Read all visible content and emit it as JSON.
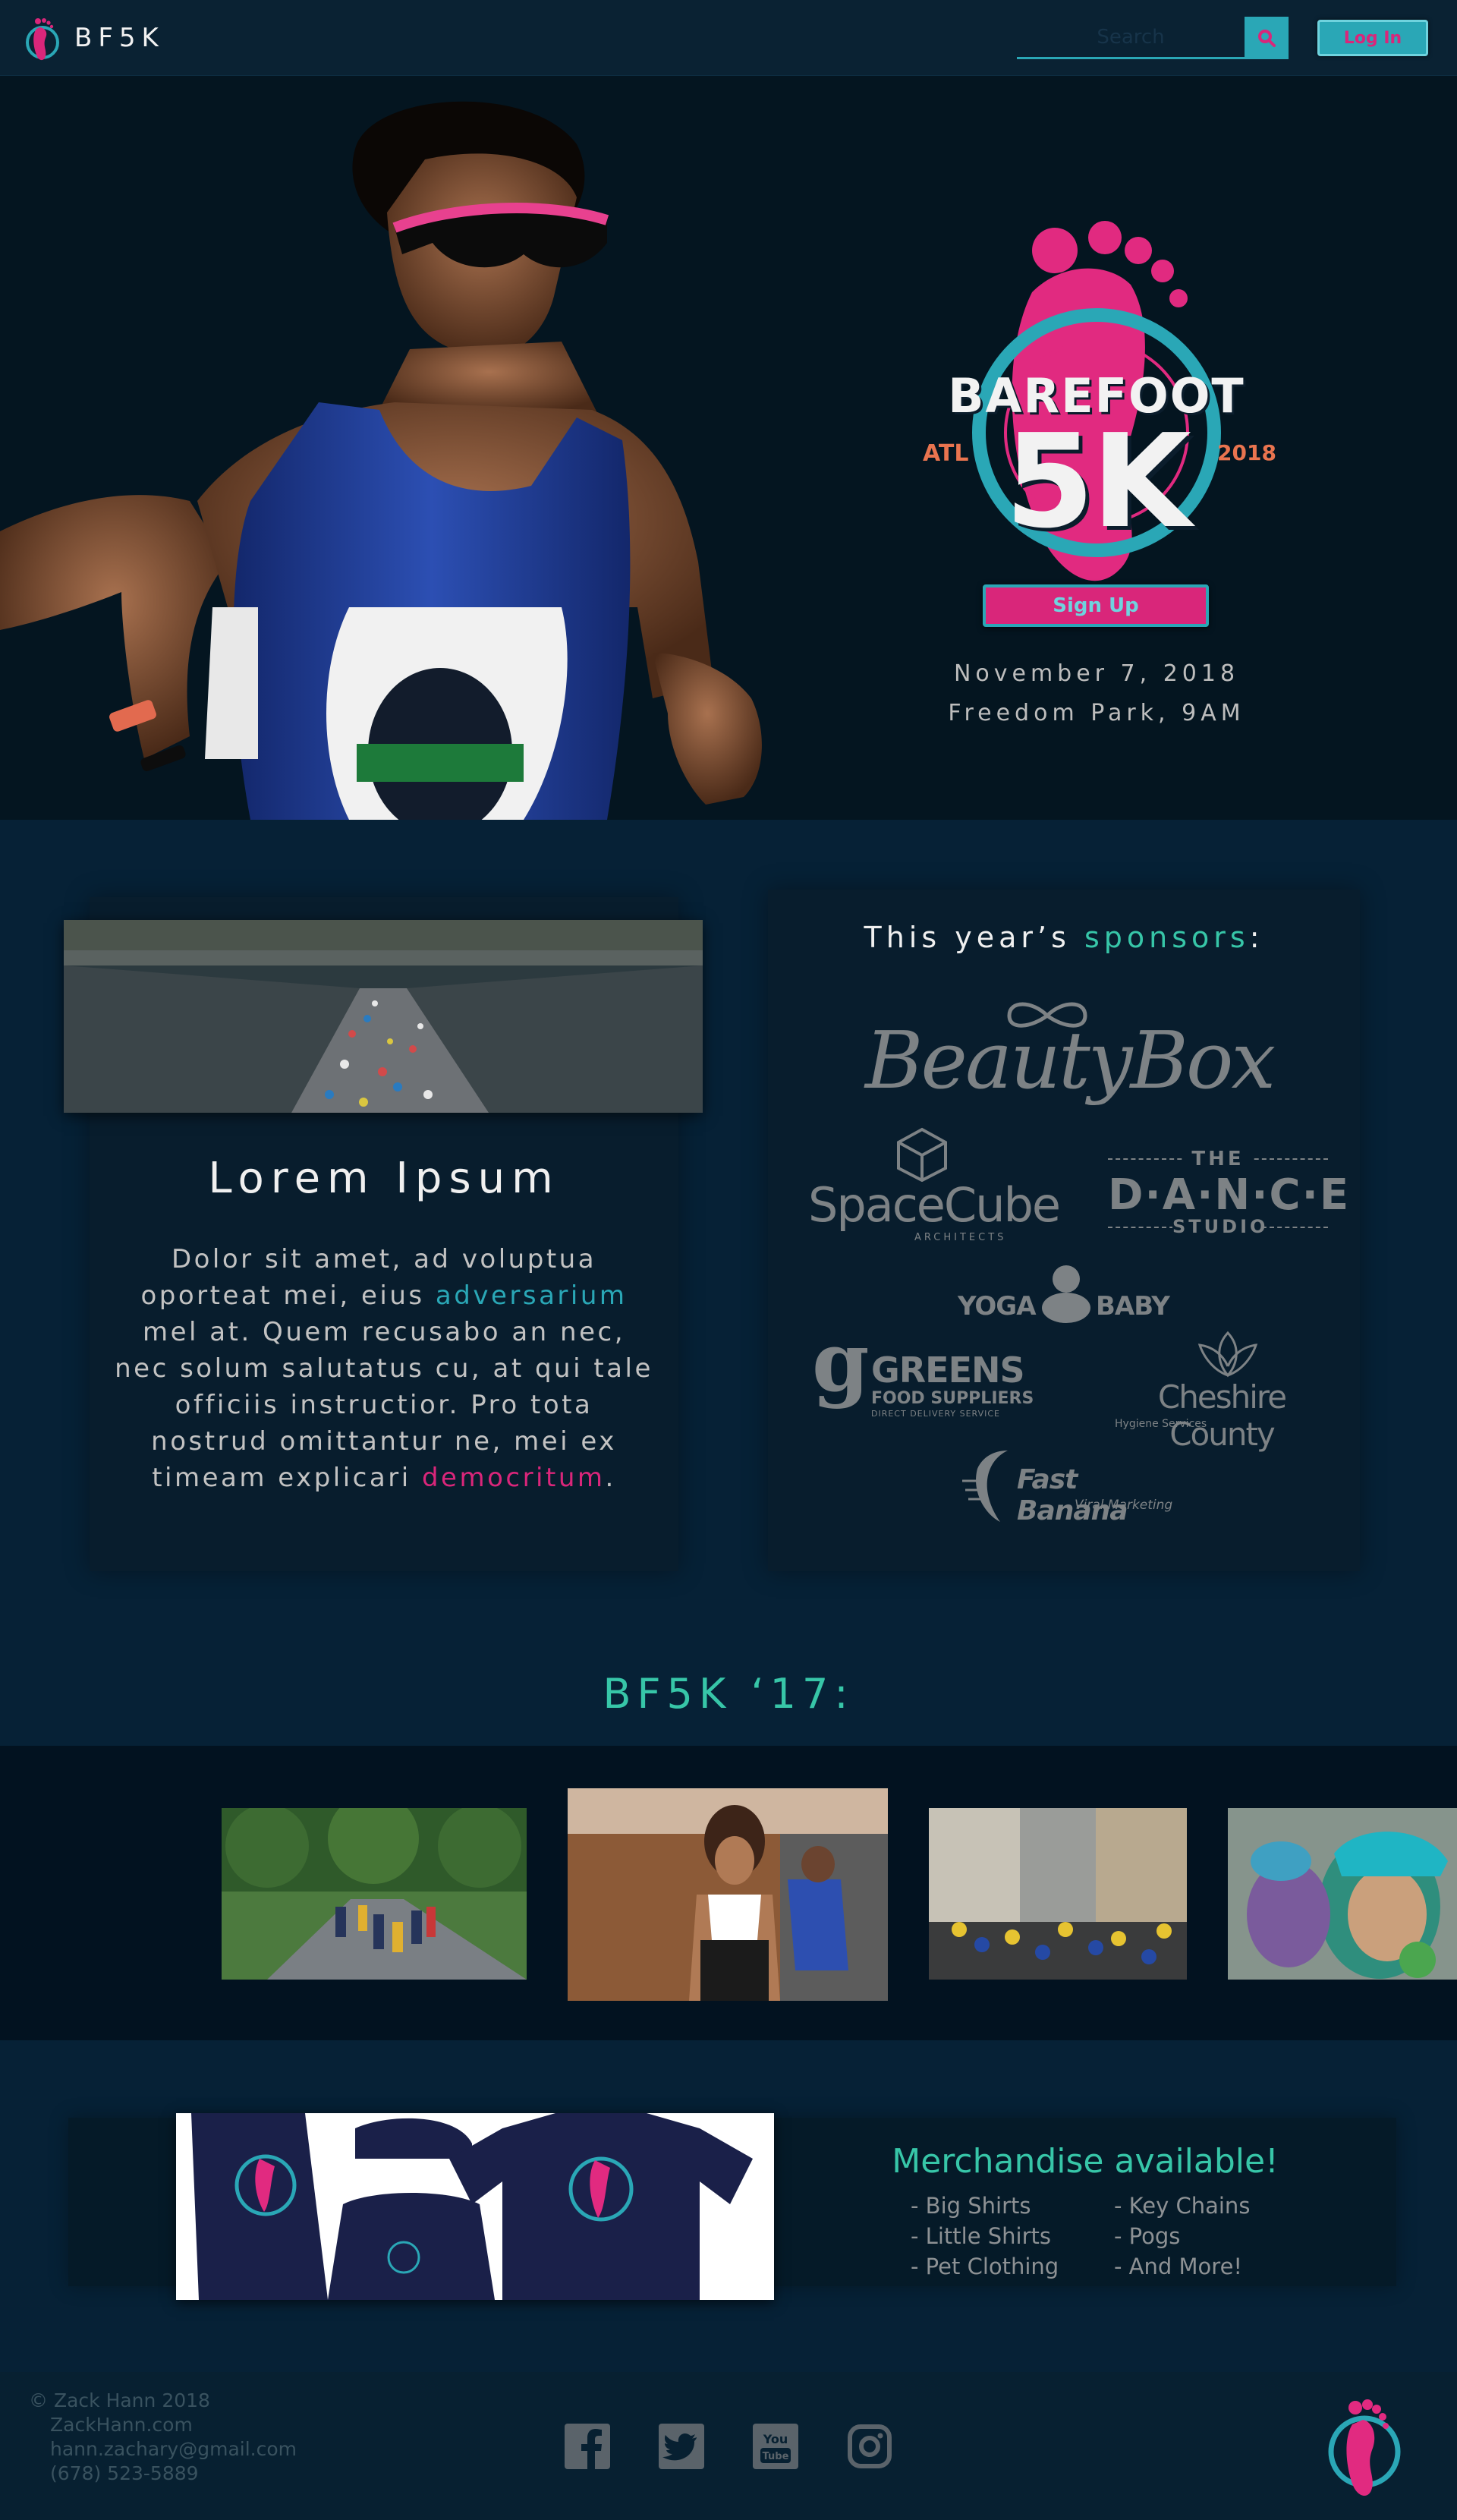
{
  "nav": {
    "brand": "BF5K",
    "search_placeholder": "Search",
    "login_label": "Log In"
  },
  "hero": {
    "logo_word_top": "BAREFOOT",
    "logo_word_main": "5K",
    "logo_left_tag": "ATL",
    "logo_right_tag": "2018",
    "signup_label": "Sign Up",
    "date": "November 7, 2018",
    "venue": "Freedom Park, 9AM"
  },
  "about": {
    "title": "Lorem Ipsum",
    "body_part1": "Dolor sit amet, ad voluptua oporteat mei, eius",
    "body_link1": "adversarium",
    "body_part2": "mel at. Quem recusabo an nec, nec solum salutatus cu, at qui tale officiis instructior. Pro tota nostrud omittantur ne, mei ex timeam explicari",
    "body_link2": "democritum",
    "body_end": "."
  },
  "sponsors": {
    "title_prefix": "This year’s",
    "title_highlight": "sponsors",
    "title_suffix": ":",
    "beauty_box": "BeautyBox",
    "spacecube": "SpaceCube",
    "spacecube_sub": "ARCHITECTS",
    "dance_the": "THE",
    "dance_main": "D·A·N·C·E",
    "dance_studio": "STUDIO",
    "yoga_left": "YOGA",
    "yoga_right": "BABY",
    "greens_main": "GREENS",
    "greens_sub1": "FOOD SUPPLIERS",
    "greens_sub2": "DIRECT DELIVERY SERVICE",
    "cheshire_main": "Cheshire County",
    "cheshire_sub": "Hygiene Services",
    "banana_main": "Fast Banana",
    "banana_sub": "Viral Marketing"
  },
  "gallery": {
    "title": "BF5K ‘17:"
  },
  "merch": {
    "title": "Merchandise available!",
    "col1": [
      "- Big Shirts",
      "- Little Shirts",
      "- Pet Clothing"
    ],
    "col2": [
      "- Key Chains",
      "- Pogs",
      "- And More!"
    ]
  },
  "footer": {
    "copyright": "© Zack Hann 2018",
    "site": "ZackHann.com",
    "email": "hann.zachary@gmail.com",
    "phone": "(678) 523-5889",
    "social": [
      "facebook-icon",
      "twitter-icon",
      "youtube-icon",
      "instagram-icon"
    ],
    "youtube_top": "You",
    "youtube_bottom": "Tube"
  },
  "colors": {
    "pink": "#d9267a",
    "teal": "#2aa7b6",
    "mint": "#37c6a8",
    "navy": "#062136"
  }
}
